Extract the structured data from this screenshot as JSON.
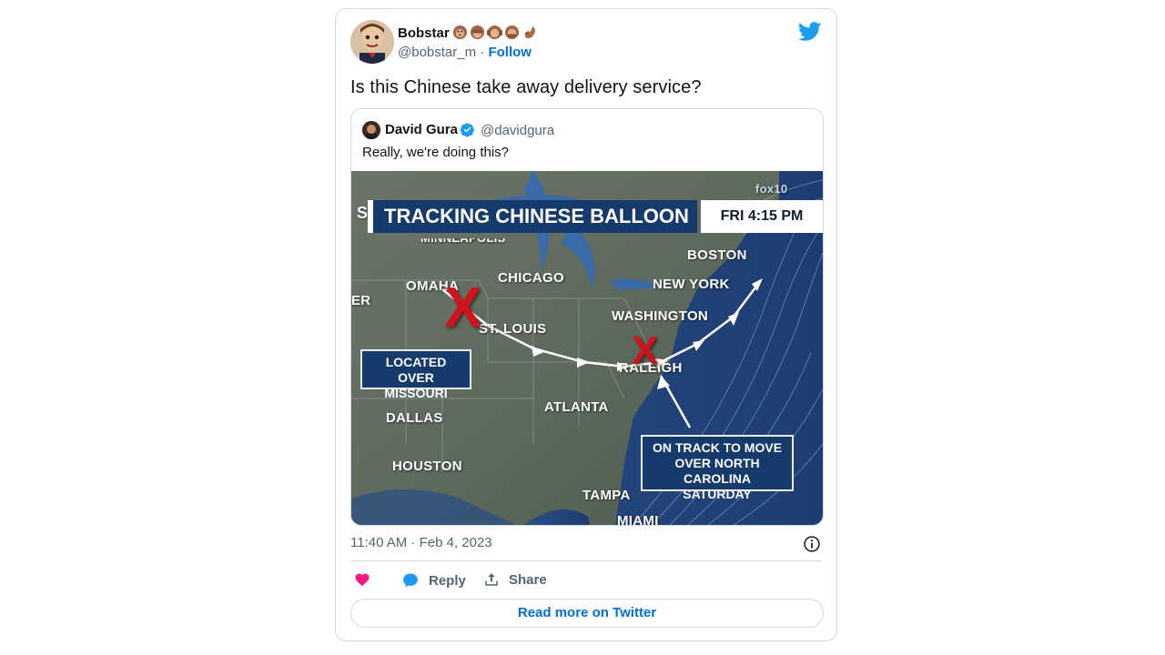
{
  "tweet": {
    "author_name": "Bobstar",
    "author_emojis": [
      "monkey-face",
      "see-no-evil-monkey",
      "hear-no-evil-monkey",
      "speak-no-evil-monkey",
      "squirrel"
    ],
    "handle": "@bobstar_m",
    "separator": "·",
    "follow_label": "Follow",
    "text": "Is this Chinese take away delivery service?",
    "timestamp": "11:40 AM · Feb 4, 2023",
    "reply_label": "Reply",
    "share_label": "Share",
    "read_more_label": "Read more on Twitter"
  },
  "quoted_tweet": {
    "author_name": "David Gura",
    "handle": "@davidgura",
    "text": "Really, we're doing this?",
    "verified": true
  },
  "map_image": {
    "title_prefix": "S",
    "title": "TRACKING CHINESE BALLOON",
    "time": "FRI 4:15 PM",
    "corner_mark": "fox10",
    "left_edge_label": "ER",
    "cities": {
      "minneapolis": "MINNEAPOLIS",
      "omaha": "OMAHA",
      "chicago": "CHICAGO",
      "st_louis": "ST. LOUIS",
      "boston": "BOSTON",
      "new_york": "NEW YORK",
      "washington": "WASHINGTON",
      "raleigh": "RALEIGH",
      "atlanta": "ATLANTA",
      "dallas": "DALLAS",
      "houston": "HOUSTON",
      "tampa": "TAMPA",
      "miami": "MIAMI"
    },
    "box_missouri": "LOCATED OVER MISSOURI",
    "box_carolina": "ON TRACK TO MOVE OVER NORTH CAROLINA SATURDAY",
    "marker": "X"
  },
  "colors": {
    "twitter_blue": "#1d9bf0",
    "link_blue": "#006fd6",
    "like_pink": "#f91880",
    "map_navy": "#153a6b",
    "marker_red": "#d3121b"
  }
}
